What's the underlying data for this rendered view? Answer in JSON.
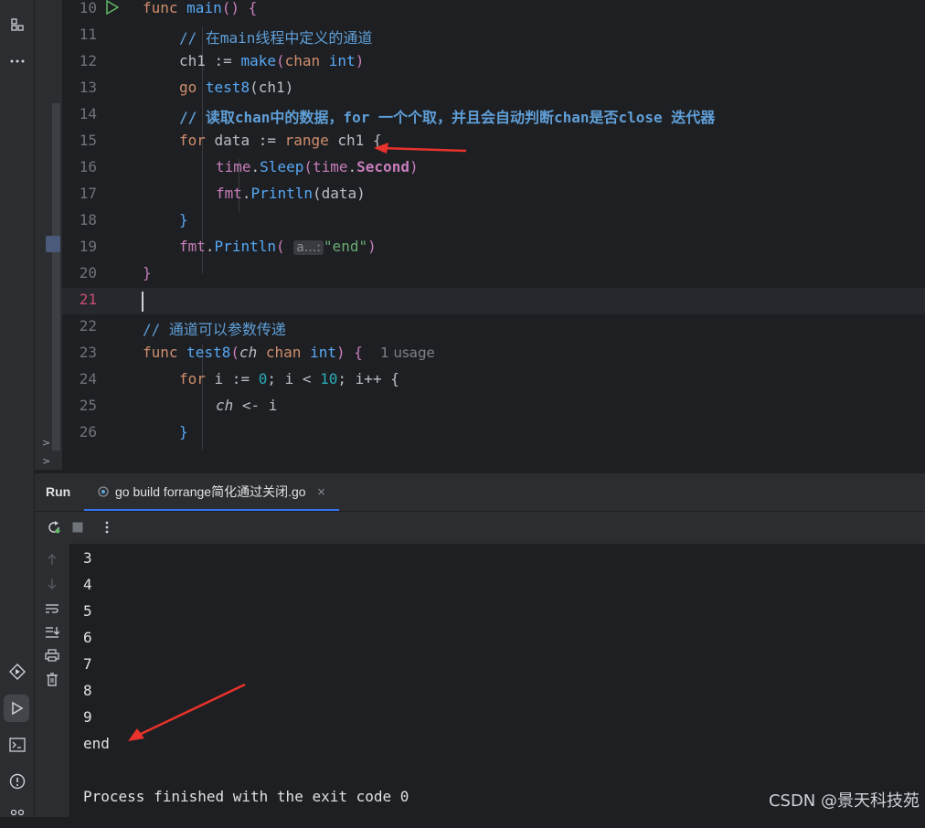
{
  "editor": {
    "lines": [
      {
        "num": "10"
      },
      {
        "num": "11"
      },
      {
        "num": "12"
      },
      {
        "num": "13"
      },
      {
        "num": "14"
      },
      {
        "num": "15"
      },
      {
        "num": "16"
      },
      {
        "num": "17"
      },
      {
        "num": "18"
      },
      {
        "num": "19"
      },
      {
        "num": "20"
      },
      {
        "num": "21"
      },
      {
        "num": "22"
      },
      {
        "num": "23"
      },
      {
        "num": "24"
      },
      {
        "num": "25"
      },
      {
        "num": "26"
      }
    ],
    "code": {
      "l10_func": "func",
      "l10_main": "main",
      "l10_rest": "() {",
      "l11_comment": "// 在main线程中定义的通道",
      "l12_a": "ch1 := ",
      "l12_make": "make",
      "l12_b": "(",
      "l12_chan": "chan",
      "l12_int": "int",
      "l12_c": ")",
      "l13_go": "go",
      "l13_fn": "test8",
      "l13_rest": "(ch1)",
      "l14_comment": "// 读取chan中的数据，for 一个个取，并且会自动判断chan是否close 迭代器",
      "l15_for": "for",
      "l15_a": " data := ",
      "l15_range": "range",
      "l15_b": " ch1 {",
      "l16_time": "time",
      "l16_dot": ".",
      "l16_sleep": "Sleep",
      "l16_paren": "(",
      "l16_time2": "time",
      "l16_second": "Second",
      "l16_close": ")",
      "l17_fmt": "fmt",
      "l17_println": "Println",
      "l17_rest": "(data)",
      "l18": "}",
      "l19_fmt": "fmt",
      "l19_println": "Println",
      "l19_open": "(",
      "l19_hint": "a...:",
      "l19_str": "\"end\"",
      "l19_close": ")",
      "l20": "}",
      "l22_comment": "// 通道可以参数传递",
      "l23_func": "func",
      "l23_name": "test8",
      "l23_open": "(",
      "l23_ch": "ch",
      "l23_chan": "chan",
      "l23_int": "int",
      "l23_close": ") {",
      "l23_usage": "1 usage",
      "l24_for": "for",
      "l24_a": " i := ",
      "l24_zero": "0",
      "l24_b": "; i < ",
      "l24_ten": "10",
      "l24_c": "; i++ {",
      "l25_ch": "ch",
      "l25_rest": " <- i",
      "l26": "}"
    }
  },
  "run_panel": {
    "label": "Run",
    "tab_label": "go build forrange简化通过关闭.go",
    "tab_close": "×",
    "output": [
      "3",
      "4",
      "5",
      "6",
      "7",
      "8",
      "9",
      "end",
      "",
      "Process finished with the exit code 0"
    ]
  },
  "watermark": "CSDN @景天科技苑",
  "colors": {
    "background": "#1e1f22",
    "panel": "#2b2d30",
    "arrow": "#e8322b",
    "tab_underline": "#3574f0"
  }
}
